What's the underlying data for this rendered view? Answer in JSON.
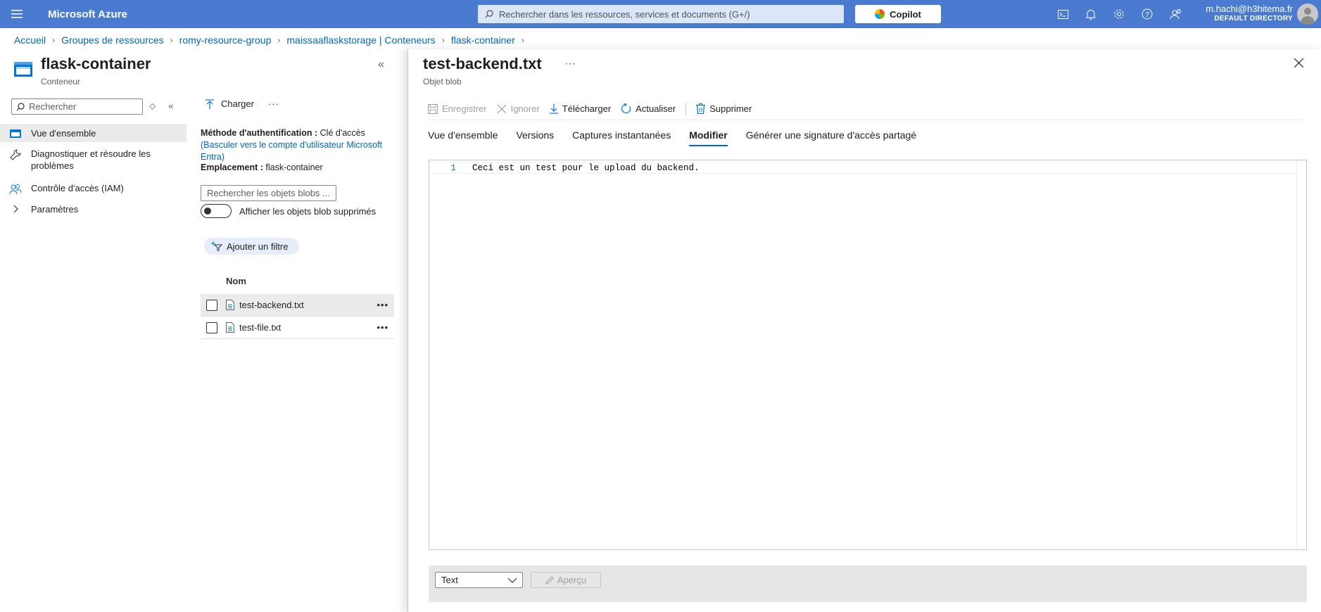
{
  "topbar": {
    "menu_icon": "hamburger-icon",
    "brand": "Microsoft Azure",
    "search_placeholder": "Rechercher dans les ressources, services et documents (G+/)",
    "copilot_label": "Copilot",
    "icons": [
      "cloud-shell-icon",
      "bell-icon",
      "gear-icon",
      "help-icon",
      "feedback-icon"
    ],
    "account_email": "m.hachi@h3hitema.fr",
    "account_directory": "DEFAULT DIRECTORY"
  },
  "breadcrumb": [
    "Accueil",
    "Groupes de ressources",
    "romy-resource-group",
    "maissaaflaskstorage | Conteneurs",
    "flask-container"
  ],
  "left": {
    "title": "flask-container",
    "subtitle": "Conteneur",
    "search_placeholder": "Rechercher",
    "nav": [
      {
        "label": "Vue d'ensemble",
        "icon": "container-icon",
        "active": true
      },
      {
        "label": "Diagnostiquer et résoudre les problèmes",
        "icon": "wrench-icon"
      },
      {
        "label": "Contrôle d'accès (IAM)",
        "icon": "people-icon"
      },
      {
        "label": "Paramètres",
        "icon": "chevron-right-icon"
      }
    ]
  },
  "middle": {
    "upload_label": "Charger",
    "auth_label": "Méthode d'authentification :",
    "auth_value": "Clé d'accès",
    "auth_link": "(Basculer vers le compte d'utilisateur Microsoft Entra)",
    "location_label": "Emplacement :",
    "location_value": "flask-container",
    "blob_search_placeholder": "Rechercher les objets blobs ...",
    "show_deleted_label": "Afficher les objets blob supprimés",
    "add_filter_label": "Ajouter un filtre",
    "column_name": "Nom",
    "rows": [
      {
        "name": "test-backend.txt",
        "selected": true
      },
      {
        "name": "test-file.txt",
        "selected": false
      }
    ]
  },
  "blade": {
    "title": "test-backend.txt",
    "subtitle": "Objet blob",
    "commands": {
      "save": "Enregistrer",
      "discard": "Ignorer",
      "download": "Télécharger",
      "refresh": "Actualiser",
      "delete": "Supprimer"
    },
    "tabs": [
      "Vue d'ensemble",
      "Versions",
      "Captures instantanées",
      "Modifier",
      "Générer une signature d'accès partagé"
    ],
    "active_tab": "Modifier",
    "editor": {
      "line_number": "1",
      "content": "Ceci est un test pour le upload du backend."
    },
    "language": "Text",
    "preview_label": "Aperçu"
  }
}
